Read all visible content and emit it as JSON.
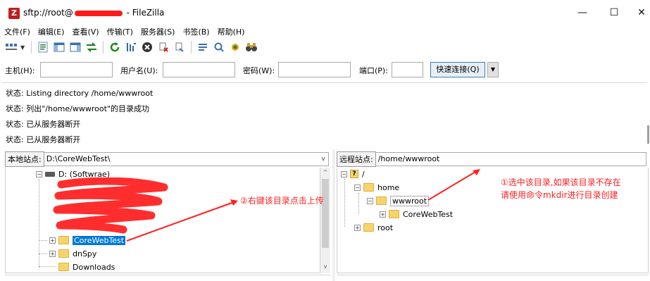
{
  "window": {
    "title_prefix": "sftp://root@",
    "title_suffix": " - FileZilla",
    "app_icon_letter": "Z",
    "minimize": "—",
    "maximize": "☐",
    "close": "✕"
  },
  "menu": [
    "文件(F)",
    "编辑(E)",
    "查看(V)",
    "传输(T)",
    "服务器(S)",
    "书签(B)",
    "帮助(H)"
  ],
  "toolbar_icons": [
    "site-manager-icon",
    "toggle-log-icon",
    "toggle-local-tree-icon",
    "toggle-remote-tree-icon",
    "toggle-queue-icon",
    "refresh-icon",
    "process-queue-icon",
    "cancel-icon",
    "disconnect-icon",
    "reconnect-icon",
    "directory-listing-filter-icon",
    "toggle-sync-browsing-icon",
    "search-icon",
    "binoculars-icon"
  ],
  "quickconnect": {
    "host_label": "主机(H):",
    "user_label": "用户名(U):",
    "pass_label": "密码(W):",
    "port_label": "端口(P):",
    "host_value": "",
    "user_value": "",
    "pass_value": "",
    "port_value": "",
    "button": "快速连接(Q)",
    "dropdown": "▼"
  },
  "log": [
    {
      "prefix": "状态:",
      "text": "Listing directory /home/wwwroot"
    },
    {
      "prefix": "状态:",
      "text": "列出\"/home/wwwroot\"的目录成功"
    },
    {
      "prefix": "状态:",
      "text": "已从服务器断开"
    },
    {
      "prefix": "状态:",
      "text": "已从服务器断开"
    }
  ],
  "local": {
    "label": "本地站点:",
    "path": "D:\\CoreWebTest\\",
    "dropdown": "v",
    "tree": {
      "drive": "D: (Softwrae)",
      "items": [
        "CoreWebTest",
        "dnSpy",
        "Downloads"
      ],
      "selected": "CoreWebTest"
    },
    "scroll_up": "^",
    "scroll_down": "v"
  },
  "remote": {
    "label": "远程站点:",
    "path": "/home/wwwroot",
    "tree": {
      "root_mark": "?",
      "root": "/",
      "home": "home",
      "wwwroot": "wwwroot",
      "child": "CoreWebTest",
      "root_dir": "root"
    }
  },
  "annotations": {
    "local_note": "②右键该目录点击上传",
    "remote_note_line1": "①选中该目录,如果该目录不存在",
    "remote_note_line2": "请使用命令mkdir进行目录创建",
    "color": "#ff2020"
  },
  "colors": {
    "selection": "#0078d7",
    "folder": "#f7d46a",
    "accent_button": "#3c7fb1",
    "redaction": "#ff1a1a"
  }
}
